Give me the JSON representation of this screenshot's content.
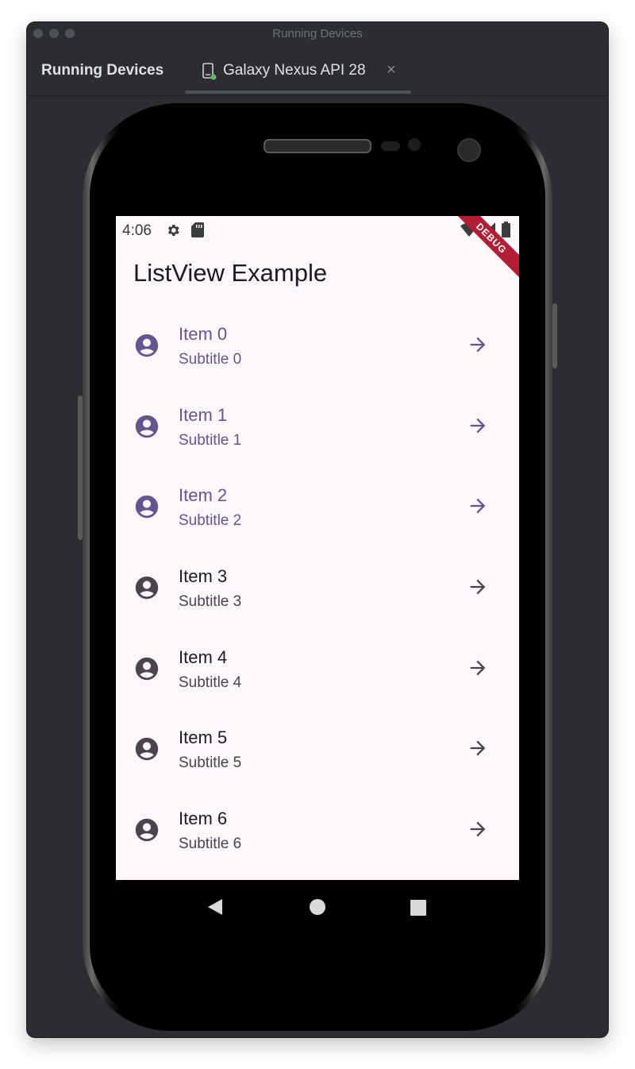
{
  "window": {
    "title": "Running Devices",
    "tool_window_title": "Running Devices",
    "tab": {
      "label": "Galaxy Nexus API 28",
      "close_label": "×",
      "icon": "device-icon"
    }
  },
  "device": {
    "status_bar": {
      "time": "4:06",
      "icons": [
        "gear-icon",
        "sd-card-icon",
        "wifi-icon",
        "signal-icon",
        "battery-icon"
      ]
    },
    "debug_banner": "DEBUG",
    "app_title": "ListView Example",
    "items": [
      {
        "title": "Item 0",
        "subtitle": "Subtitle 0",
        "selected": true
      },
      {
        "title": "Item 1",
        "subtitle": "Subtitle 1",
        "selected": true
      },
      {
        "title": "Item 2",
        "subtitle": "Subtitle 2",
        "selected": true
      },
      {
        "title": "Item 3",
        "subtitle": "Subtitle 3",
        "selected": false
      },
      {
        "title": "Item 4",
        "subtitle": "Subtitle 4",
        "selected": false
      },
      {
        "title": "Item 5",
        "subtitle": "Subtitle 5",
        "selected": false
      },
      {
        "title": "Item 6",
        "subtitle": "Subtitle 6",
        "selected": false
      }
    ],
    "nav_buttons": [
      "back-icon",
      "home-icon",
      "recents-icon"
    ]
  },
  "colors": {
    "selected": "#65558f",
    "default_title": "#1d1b20",
    "default_icon": "#49454f",
    "debug": "#b21e35"
  }
}
